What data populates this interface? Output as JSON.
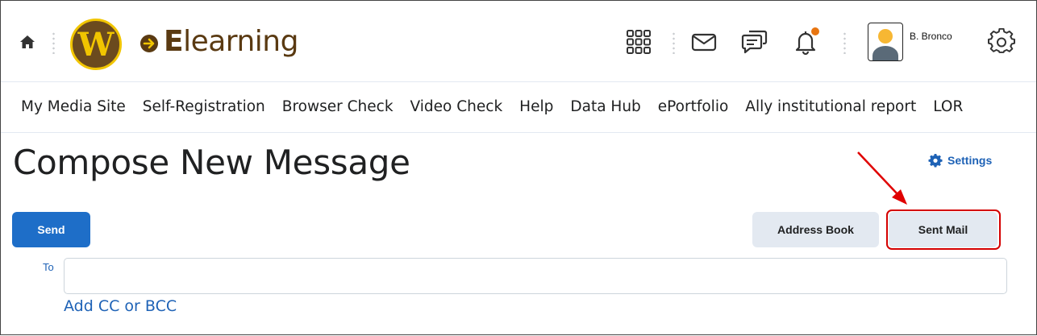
{
  "header": {
    "brand_initial": "E",
    "brand_rest": "learning",
    "logo_letter": "W",
    "user_name": "B. Bronco",
    "icons": [
      "home-icon",
      "app-grid-icon",
      "mail-icon",
      "chat-icon",
      "bell-icon",
      "gear-icon"
    ],
    "notification_color": "#e87511"
  },
  "nav": {
    "items": [
      "My Media Site",
      "Self-Registration",
      "Browser Check",
      "Video Check",
      "Help",
      "Data Hub",
      "ePortfolio",
      "Ally institutional report",
      "LOR"
    ]
  },
  "page": {
    "title": "Compose New Message",
    "settings_label": "Settings"
  },
  "toolbar": {
    "send_label": "Send",
    "address_book_label": "Address Book",
    "sent_mail_label": "Sent Mail"
  },
  "form": {
    "to_label": "To",
    "to_value": "",
    "add_cc_label": "Add CC or BCC"
  },
  "colors": {
    "accent": "#1e6ec8",
    "brand_brown": "#5a3a12",
    "brand_gold": "#f1c500",
    "annotation_red": "#d40000"
  }
}
